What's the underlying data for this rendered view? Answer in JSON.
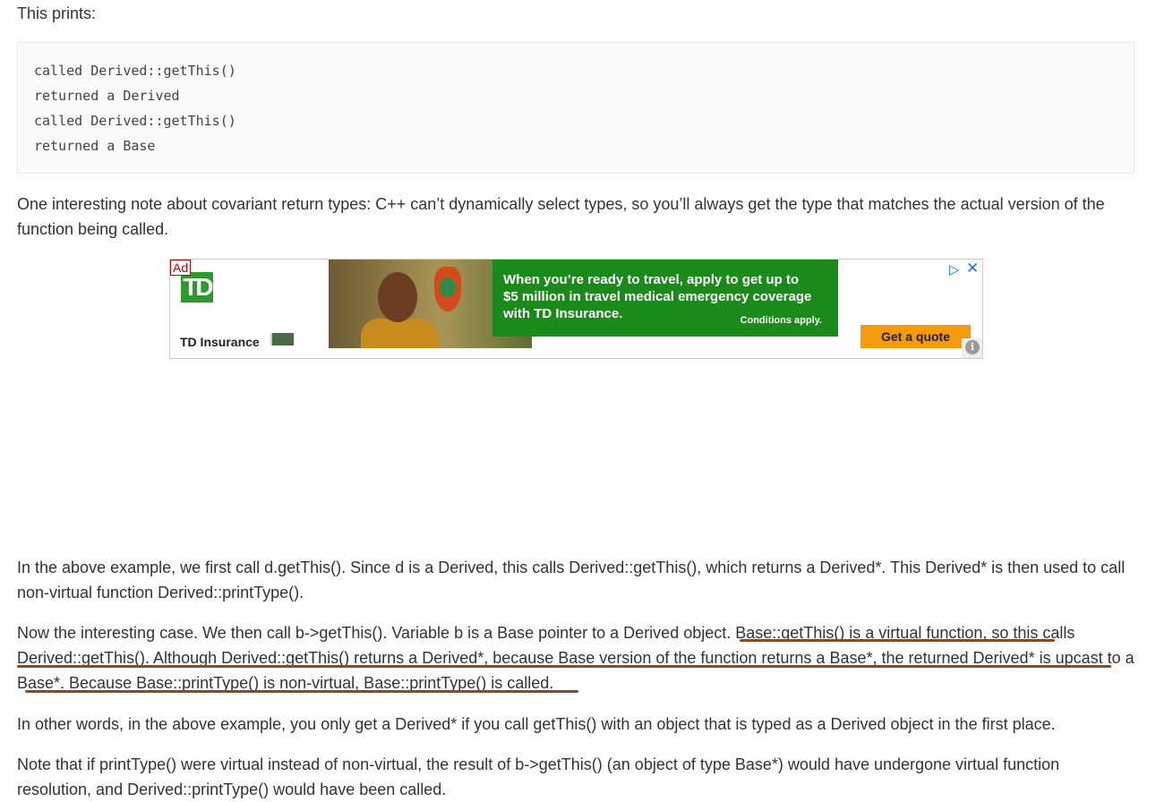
{
  "intro": "This prints:",
  "code_lines": [
    "called Derived::getThis()",
    "returned a Derived",
    "called Derived::getThis()",
    "returned a Base"
  ],
  "note": "One interesting note about covariant return types: C++ can’t dynamically select types, so you’ll always get the type that matches the actual version of the function being called.",
  "ad": {
    "badge": "Ad",
    "logo_text": "TD",
    "brand": "TD Insurance",
    "message_1": "When you’re ready to travel, apply to get up to",
    "message_2_bold": "$5 million",
    "message_2_rest": " in travel medical emergency coverage",
    "message_3": "with TD Insurance.",
    "conditions": "Conditions apply.",
    "cta": "Get a quote",
    "adchoices_glyph": "▷",
    "close_glyph": "✕",
    "info_glyph": "i",
    "brand_color": "#1a8a1a",
    "cta_color": "#f59a0b"
  },
  "para1": "In the above example, we first call d.getThis(). Since d is a Derived, this calls Derived::getThis(), which returns a Derived*. This Derived* is then used to call non-virtual function Derived::printType().",
  "para2_plain": "Now the interesting case. We then call b->getThis(). Variable b is a Base pointer to a Derived object. ",
  "para2_marked": "Base::getThis() is a virtual function, so this calls Derived::getThis(). Although Derived::getThis() returns a Derived*, because Base version of the function returns a Base*, the returned Derived* is upcast to a Base*. Because Base::printType() is non-virtual, Base::printType() is called",
  "para2_end": ".",
  "para3": "In other words, in the above example, you only get a Derived* if you call getThis() with an object that is typed as a Derived object in the first place.",
  "para4": "Note that if printType() were virtual instead of non-virtual, the result of b->getThis() (an object of type Base*) would have undergone virtual function resolution, and Derived::printType() would have been called."
}
